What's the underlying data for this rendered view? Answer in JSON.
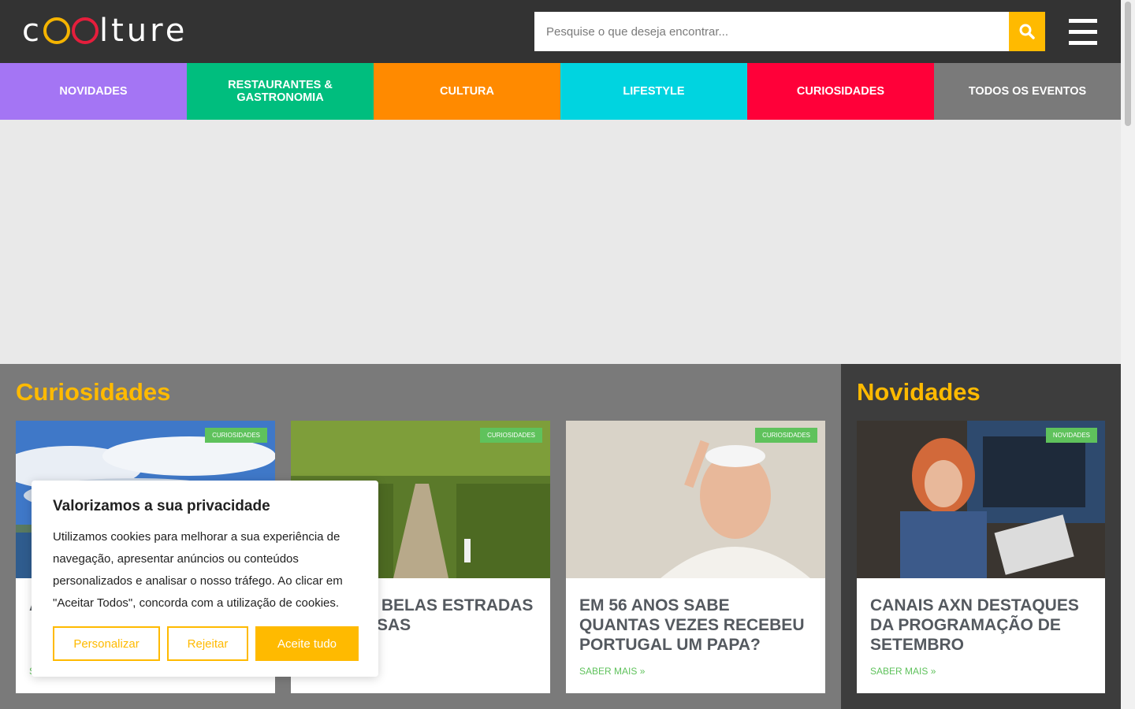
{
  "header": {
    "logo_prefix": "c",
    "logo_suffix": "lture",
    "search_placeholder": "Pesquise o que deseja encontrar..."
  },
  "nav": {
    "items": [
      {
        "label": "NOVIDADES",
        "color": "#a475f4"
      },
      {
        "label": "RESTAURANTES & GASTRONOMIA",
        "color": "#00be7e"
      },
      {
        "label": "CULTURA",
        "color": "#ff8a00"
      },
      {
        "label": "LIFESTYLE",
        "color": "#00d4e0"
      },
      {
        "label": "CURIOSIDADES",
        "color": "#ff0039"
      },
      {
        "label": "TODOS OS EVENTOS",
        "color": "#7a7a7a"
      }
    ]
  },
  "curiosidades": {
    "title": "Curiosidades",
    "cards": [
      {
        "badge": "CURIOSIDADES",
        "title": "A",
        "read_more": "S"
      },
      {
        "badge": "CURIOSIDADES",
        "title": "S BELAS ESTRADAS ESAS",
        "read_more": ""
      },
      {
        "badge": "CURIOSIDADES",
        "title": "EM 56 ANOS SABE QUANTAS VEZES RECEBEU PORTUGAL UM PAPA?",
        "read_more": "SABER MAIS »"
      }
    ]
  },
  "novidades": {
    "title": "Novidades",
    "cards": [
      {
        "badge": "NOVIDADES",
        "title": "CANAIS AXN DESTAQUES DA PROGRAMAÇÃO DE SETEMBRO",
        "read_more": "SABER MAIS »"
      }
    ]
  },
  "cookie": {
    "title": "Valorizamos a sua privacidade",
    "text": "Utilizamos cookies para melhorar a sua experiência de navegação, apresentar anúncios ou conteúdos personalizados e analisar o nosso tráfego. Ao clicar em \"Aceitar Todos\", concorda com a utilização de cookies.",
    "customize_label": "Personalizar",
    "reject_label": "Rejeitar",
    "accept_label": "Aceite tudo"
  },
  "colors": {
    "accent": "#ffba00",
    "header_bg": "#333333",
    "badge": "#5fc25c"
  }
}
